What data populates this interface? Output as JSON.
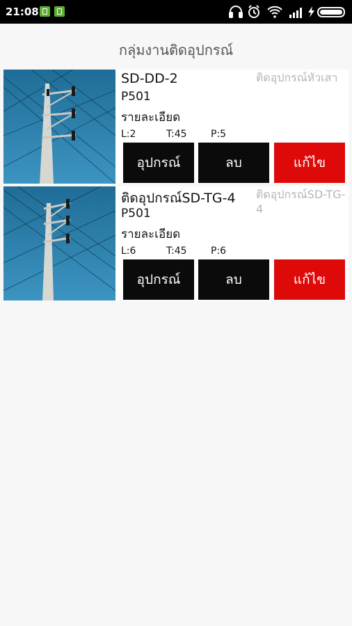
{
  "status_bar": {
    "time": "21:08",
    "icons": [
      "notification-app-icon",
      "notification-app-icon",
      "headset-icon",
      "alarm-icon",
      "wifi-icon",
      "signal-icon",
      "charging-icon",
      "battery-icon"
    ]
  },
  "header": {
    "title": "กลุ่มงานติดอุปกรณ์"
  },
  "colors": {
    "status_bar": "#000000",
    "background": "#f7f7f7",
    "button_dark": "#0b0b0b",
    "button_edit": "#de0a0a",
    "secondary_text": "#b5b5b5"
  },
  "items": [
    {
      "title": "SD-DD-2",
      "code": "P501",
      "detail_label": "รายละเอียด",
      "side_text": "ติดอุปกรณ์หัวเสา",
      "stat_l": "L:2",
      "stat_t": "T:45",
      "stat_p": "P:5",
      "btn_equipment": "อุปกรณ์",
      "btn_delete": "ลบ",
      "btn_edit": "แก้ไข"
    },
    {
      "title": "ติดอุปกรณ์SD-TG-4",
      "code": "P501",
      "detail_label": "รายละเอียด",
      "side_text": "ติดอุปกรณ์SD-TG-4",
      "stat_l": "L:6",
      "stat_t": "T:45",
      "stat_p": "P:6",
      "btn_equipment": "อุปกรณ์",
      "btn_delete": "ลบ",
      "btn_edit": "แก้ไข"
    }
  ]
}
